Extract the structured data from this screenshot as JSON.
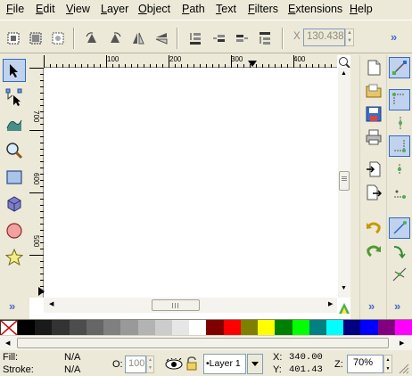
{
  "menubar": {
    "items": [
      "File",
      "Edit",
      "View",
      "Layer",
      "Object",
      "Path",
      "Text",
      "Filters",
      "Extensions",
      "Help"
    ]
  },
  "toolbar": {
    "x_label": "X",
    "x_value": "130.438",
    "overflow": "»",
    "buttons": [
      "select-all-icon",
      "select-all-layers-icon",
      "deselect-icon",
      "rotate-ccw-icon",
      "rotate-cw-icon",
      "flip-horizontal-icon",
      "flip-vertical-icon",
      "lower-to-bottom-icon",
      "lower-icon",
      "raise-icon",
      "raise-to-top-icon"
    ]
  },
  "rulers": {
    "h_ticks": [
      "100",
      "200",
      "300",
      "400"
    ],
    "v_ticks": [
      "700",
      "600",
      "500"
    ]
  },
  "left_tools": [
    "selector-tool",
    "node-tool",
    "tweak-tool",
    "zoom-tool",
    "rectangle-tool",
    "3d-box-tool",
    "ellipse-tool",
    "star-tool"
  ],
  "left_overflow": "»",
  "right_commands": [
    "new-document-icon",
    "open-icon",
    "save-icon",
    "print-icon",
    "import-icon",
    "export-icon",
    "undo-icon",
    "redo-icon"
  ],
  "snap_controls": [
    "snap-enable-icon",
    "snap-bbox-icon",
    "snap-bbox-edge-icon",
    "snap-bbox-corner-icon",
    "snap-bbox-midpoint-icon",
    "snap-center-icon",
    "snap-nodes-icon",
    "snap-path-icon",
    "snap-intersection-icon"
  ],
  "palette": {
    "colors": [
      "#000000",
      "#1a1a1a",
      "#333333",
      "#4d4d4d",
      "#666666",
      "#808080",
      "#999999",
      "#b3b3b3",
      "#cccccc",
      "#e6e6e6",
      "#ffffff",
      "#800000",
      "#ff0000",
      "#808000",
      "#ffff00",
      "#008000",
      "#00ff00",
      "#008080",
      "#00ffff",
      "#000080",
      "#0000ff",
      "#800080",
      "#ff00ff"
    ]
  },
  "status": {
    "fill_label": "Fill:",
    "fill_value": "N/A",
    "stroke_label": "Stroke:",
    "stroke_value": "N/A",
    "opacity_label": "O:",
    "opacity_value": "100",
    "layer_name": "•Layer 1",
    "x_label": "X:",
    "x_value": "340.00",
    "y_label": "Y:",
    "y_value": "401.43",
    "zoom_label": "Z:",
    "zoom_value": "70%"
  }
}
